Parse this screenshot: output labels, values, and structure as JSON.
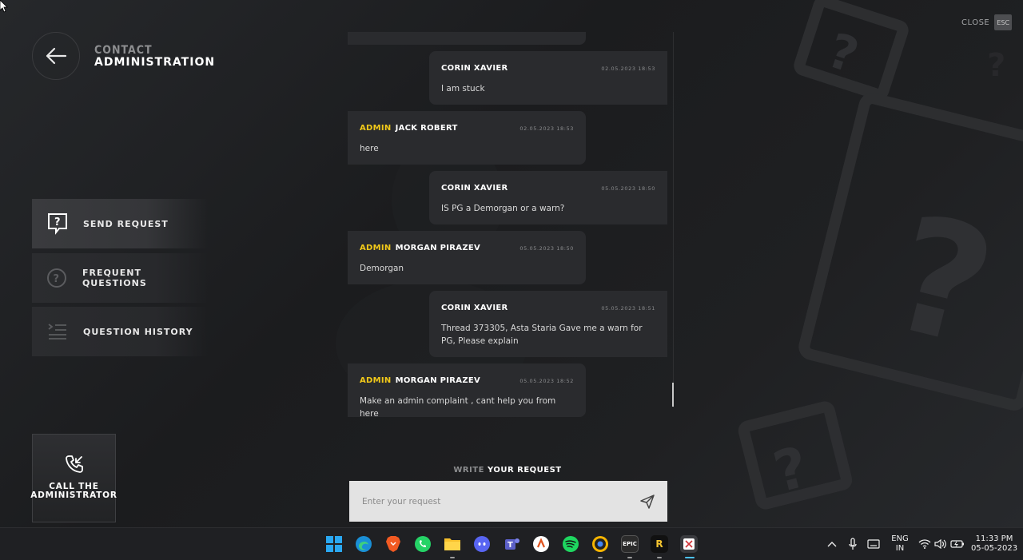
{
  "header": {
    "title_line1": "CONTACT",
    "title_line2": "ADMINISTRATION"
  },
  "close": {
    "label": "CLOSE",
    "key": "ESC"
  },
  "menu": [
    {
      "label": "SEND REQUEST",
      "icon": "question-bubble-icon",
      "active": true
    },
    {
      "label": "FREQUENT QUESTIONS",
      "icon": "question-circle-icon",
      "active": false
    },
    {
      "label": "QUESTION HISTORY",
      "icon": "list-icon",
      "active": false
    }
  ],
  "call_box": {
    "line1": "CALL THE",
    "line2": "ADMINISTRATOR",
    "icon": "phone-incoming-icon"
  },
  "messages": [
    {
      "side": "right",
      "admin": "",
      "name": "CORIN XAVIER",
      "time": "02.05.2023 18:53",
      "text": "I am stuck"
    },
    {
      "side": "left",
      "admin": "ADMIN",
      "name": "JACK ROBERT",
      "time": "02.05.2023 18:53",
      "text": "here"
    },
    {
      "side": "right",
      "admin": "",
      "name": "CORIN XAVIER",
      "time": "05.05.2023 18:50",
      "text": "IS PG a Demorgan or a warn?"
    },
    {
      "side": "left",
      "admin": "ADMIN",
      "name": "MORGAN PIRAZEV",
      "time": "05.05.2023 18:50",
      "text": "Demorgan"
    },
    {
      "side": "right",
      "admin": "",
      "name": "CORIN XAVIER",
      "time": "05.05.2023 18:51",
      "text": "Thread 373305, Asta Staria Gave me a warn for PG, Please explain"
    },
    {
      "side": "left",
      "admin": "ADMIN",
      "name": "MORGAN PIRAZEV",
      "time": "05.05.2023 18:52",
      "text": "Make an admin complaint , cant help you from here"
    }
  ],
  "composer": {
    "label_prefix": "WRITE",
    "label_rest": "YOUR REQUEST",
    "placeholder": "Enter your request"
  },
  "taskbar": {
    "apps": [
      "start",
      "edge",
      "brave",
      "whatsapp",
      "file-explorer",
      "discord",
      "teams",
      "notion-like",
      "spotify",
      "chrome-canary",
      "epic-games",
      "rockstar",
      "snipping-tool"
    ],
    "epic_label": "EPIC",
    "rockstar_label": "R",
    "language_line1": "ENG",
    "language_line2": "IN",
    "time": "11:33 PM",
    "date": "05-05-2023"
  },
  "colors": {
    "admin_accent": "#f2c919",
    "bubble_bg": "#2a2b2e",
    "background": "#1c1d1f"
  }
}
